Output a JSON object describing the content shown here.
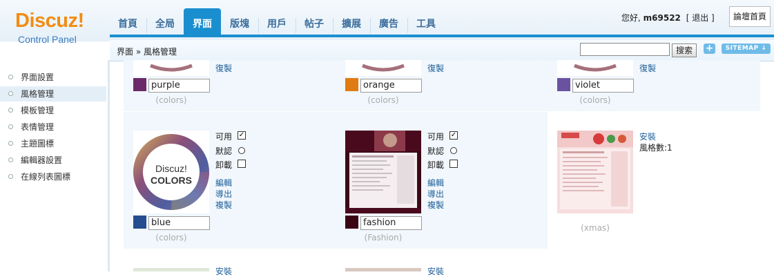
{
  "logo": {
    "main": "Discuz!",
    "sub": "Control Panel"
  },
  "nav": {
    "items": [
      "首頁",
      "全局",
      "界面",
      "版塊",
      "用戶",
      "帖子",
      "擴展",
      "廣告",
      "工具"
    ],
    "active_index": 2
  },
  "user": {
    "greeting": "您好,",
    "username": "m69522",
    "logout": "[ 退出 ]"
  },
  "home_button": "論壇首頁",
  "breadcrumb": "界面 » 風格管理",
  "search": {
    "value": "",
    "button": "搜索"
  },
  "plus_button": "+",
  "sitemap_button": "SITEMAP ↓",
  "sidebar": {
    "items": [
      "界面設置",
      "風格管理",
      "模板管理",
      "表情管理",
      "主題圖標",
      "編輯器設置",
      "在線列表圖標"
    ],
    "active_index": 1
  },
  "styles_row1": [
    {
      "name": "purple",
      "caption": "(colors)",
      "link": "復製",
      "color": "#6b2a6a"
    },
    {
      "name": "orange",
      "caption": "(colors)",
      "link": "復製",
      "color": "#e07b12"
    },
    {
      "name": "violet",
      "caption": "(colors)",
      "link": "復製",
      "color": "#6a52a0"
    }
  ],
  "styles_row2": [
    {
      "name": "blue",
      "caption": "(colors)",
      "color": "#244c8e",
      "thumb_title": "Discuz!",
      "thumb_sub": "COLORS",
      "enabled_label": "可用",
      "enabled": true,
      "default_label": "默認",
      "uninstall_label": "卸載",
      "links": [
        "編輯",
        "導出",
        "複製"
      ]
    },
    {
      "name": "fashion",
      "caption": "(Fashion)",
      "color": "#3a0614",
      "enabled_label": "可用",
      "enabled": true,
      "default_label": "默認",
      "uninstall_label": "卸載",
      "links": [
        "編輯",
        "導出",
        "複製"
      ]
    }
  ],
  "xmas": {
    "caption": "(xmas)",
    "install": "安裝",
    "count_label": "風格數:1"
  },
  "row3_links": [
    "安裝",
    "安裝"
  ]
}
